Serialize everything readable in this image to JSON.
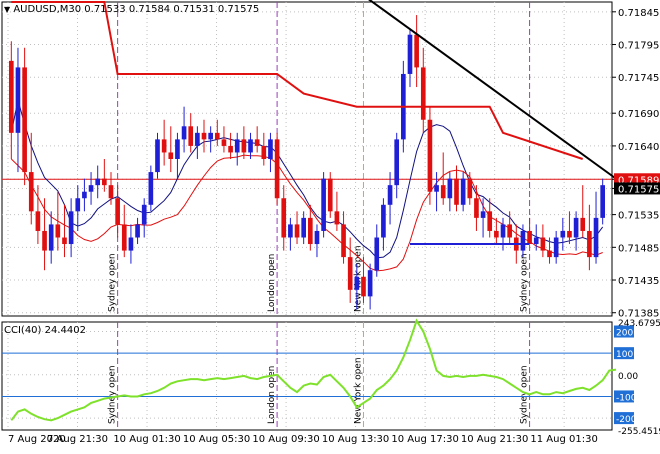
{
  "header": {
    "symbol": "AUDUSD,M30",
    "ohlc": "0.71533 0.71584 0.71531 0.71575",
    "text": "AUDUSD,M30  0.71533 0.71584 0.71531 0.71575"
  },
  "colors": {
    "background": "#ffffff",
    "grid": "#c0c0c0",
    "bull_candle": "#1f1fd6",
    "bear_candle": "#e01010",
    "trendline": "#000000",
    "resistance_line": "#e01010",
    "support_line": "#1f1fd6",
    "ma_fast": "#e01010",
    "ma_slow": "#101080",
    "cci_line": "#7ee12a",
    "session_line": "#9a3fb8",
    "ny_line": "#f0a020",
    "price_tag_current": "#000000",
    "price_tag_red": "#e01010",
    "cci_level_200": "#1f6fd6",
    "cci_level_minus100": "#1f6fd6"
  },
  "chart_data": [
    {
      "type": "candlestick",
      "title": "AUDUSD,M30",
      "price_axis_ticks": [
        "0.71845",
        "0.71795",
        "0.71745",
        "0.71690",
        "0.71640",
        "0.71589",
        "0.71575",
        "0.71535",
        "0.71485",
        "0.71435",
        "0.71385"
      ],
      "current_price": "0.71575",
      "horizontal_level": "0.71589",
      "ylim": [
        0.7138,
        0.7186
      ],
      "time_axis_labels": [
        "7 Aug 2020",
        "7 Aug 21:30",
        "10 Aug 01:30",
        "10 Aug 05:30",
        "10 Aug 09:30",
        "10 Aug 13:30",
        "10 Aug 17:30",
        "10 Aug 21:30",
        "11 Aug 01:30"
      ],
      "session_markers": [
        {
          "label": "Sydney open",
          "index": 16
        },
        {
          "label": "London open",
          "index": 40
        },
        {
          "label": "New York open",
          "index": 53
        },
        {
          "label": "Sydney open",
          "index": 78
        }
      ],
      "candles": [
        [
          0.7177,
          0.718,
          0.7162,
          0.7166
        ],
        [
          0.7166,
          0.7179,
          0.716,
          0.7176
        ],
        [
          0.7176,
          0.7179,
          0.7158,
          0.716
        ],
        [
          0.716,
          0.7166,
          0.7152,
          0.7154
        ],
        [
          0.7154,
          0.7158,
          0.7149,
          0.7151
        ],
        [
          0.7151,
          0.7156,
          0.7145,
          0.7148
        ],
        [
          0.7148,
          0.7154,
          0.7146,
          0.7152
        ],
        [
          0.7152,
          0.7157,
          0.7148,
          0.715
        ],
        [
          0.715,
          0.7155,
          0.7147,
          0.7149
        ],
        [
          0.7149,
          0.7156,
          0.7147,
          0.7154
        ],
        [
          0.7154,
          0.7158,
          0.7151,
          0.7156
        ],
        [
          0.7156,
          0.7159,
          0.7154,
          0.7157
        ],
        [
          0.7157,
          0.716,
          0.7155,
          0.7158
        ],
        [
          0.7158,
          0.7161,
          0.7156,
          0.7159
        ],
        [
          0.7159,
          0.7162,
          0.7157,
          0.7158
        ],
        [
          0.7158,
          0.716,
          0.7155,
          0.7156
        ],
        [
          0.7156,
          0.7158,
          0.715,
          0.7152
        ],
        [
          0.7152,
          0.7155,
          0.7147,
          0.7148
        ],
        [
          0.7148,
          0.7152,
          0.7146,
          0.715
        ],
        [
          0.715,
          0.7153,
          0.7149,
          0.7152
        ],
        [
          0.7152,
          0.7156,
          0.715,
          0.7155
        ],
        [
          0.7155,
          0.7161,
          0.7154,
          0.716
        ],
        [
          0.716,
          0.7166,
          0.7159,
          0.7165
        ],
        [
          0.7165,
          0.7168,
          0.7161,
          0.7163
        ],
        [
          0.7163,
          0.7167,
          0.716,
          0.7162
        ],
        [
          0.7162,
          0.7166,
          0.7159,
          0.7165
        ],
        [
          0.7165,
          0.717,
          0.7163,
          0.7167
        ],
        [
          0.7167,
          0.7169,
          0.7163,
          0.7164
        ],
        [
          0.7164,
          0.7167,
          0.7162,
          0.7166
        ],
        [
          0.7166,
          0.7168,
          0.7163,
          0.7165
        ],
        [
          0.7165,
          0.7167,
          0.7163,
          0.7166
        ],
        [
          0.7166,
          0.7168,
          0.7164,
          0.7165
        ],
        [
          0.7165,
          0.7167,
          0.7163,
          0.7164
        ],
        [
          0.7164,
          0.7166,
          0.7162,
          0.7163
        ],
        [
          0.7163,
          0.7166,
          0.7161,
          0.7165
        ],
        [
          0.7165,
          0.7167,
          0.7162,
          0.7163
        ],
        [
          0.7163,
          0.7166,
          0.7162,
          0.7165
        ],
        [
          0.7165,
          0.7167,
          0.7163,
          0.7164
        ],
        [
          0.7164,
          0.7166,
          0.7161,
          0.7162
        ],
        [
          0.7162,
          0.7166,
          0.716,
          0.7165
        ],
        [
          0.7165,
          0.7166,
          0.7155,
          0.7156
        ],
        [
          0.7156,
          0.7158,
          0.7148,
          0.715
        ],
        [
          0.715,
          0.7153,
          0.7148,
          0.7152
        ],
        [
          0.7152,
          0.7154,
          0.7149,
          0.715
        ],
        [
          0.715,
          0.7154,
          0.7149,
          0.7153
        ],
        [
          0.7153,
          0.7155,
          0.7148,
          0.7149
        ],
        [
          0.7149,
          0.7152,
          0.7147,
          0.7151
        ],
        [
          0.7151,
          0.716,
          0.715,
          0.7159
        ],
        [
          0.7159,
          0.716,
          0.7153,
          0.7154
        ],
        [
          0.7154,
          0.7157,
          0.7151,
          0.7152
        ],
        [
          0.7152,
          0.7154,
          0.7146,
          0.7147
        ],
        [
          0.7147,
          0.715,
          0.714,
          0.7142
        ],
        [
          0.7142,
          0.7146,
          0.7139,
          0.7144
        ],
        [
          0.7144,
          0.7147,
          0.714,
          0.7141
        ],
        [
          0.7141,
          0.7146,
          0.7139,
          0.7145
        ],
        [
          0.7145,
          0.7152,
          0.7144,
          0.715
        ],
        [
          0.715,
          0.7156,
          0.7148,
          0.7155
        ],
        [
          0.7155,
          0.716,
          0.7152,
          0.7158
        ],
        [
          0.7158,
          0.7166,
          0.7156,
          0.7165
        ],
        [
          0.7165,
          0.7177,
          0.7163,
          0.7175
        ],
        [
          0.7175,
          0.7182,
          0.7173,
          0.7181
        ],
        [
          0.7181,
          0.7184,
          0.7173,
          0.7176
        ],
        [
          0.7176,
          0.7179,
          0.7166,
          0.7168
        ],
        [
          0.7168,
          0.717,
          0.7155,
          0.7157
        ],
        [
          0.7157,
          0.716,
          0.7154,
          0.7158
        ],
        [
          0.7158,
          0.7163,
          0.7155,
          0.7156
        ],
        [
          0.7156,
          0.716,
          0.7154,
          0.7159
        ],
        [
          0.7159,
          0.7161,
          0.7154,
          0.7155
        ],
        [
          0.7155,
          0.716,
          0.7154,
          0.7159
        ],
        [
          0.7159,
          0.716,
          0.7155,
          0.7156
        ],
        [
          0.7156,
          0.7158,
          0.7151,
          0.7153
        ],
        [
          0.7153,
          0.7156,
          0.715,
          0.7154
        ],
        [
          0.7154,
          0.7156,
          0.715,
          0.7151
        ],
        [
          0.7151,
          0.7153,
          0.7149,
          0.715
        ],
        [
          0.715,
          0.7153,
          0.7148,
          0.7152
        ],
        [
          0.7152,
          0.7154,
          0.7149,
          0.715
        ],
        [
          0.715,
          0.7152,
          0.7146,
          0.7148
        ],
        [
          0.7148,
          0.7152,
          0.7147,
          0.7151
        ],
        [
          0.7151,
          0.7153,
          0.7149,
          0.7149
        ],
        [
          0.7149,
          0.7152,
          0.7148,
          0.715
        ],
        [
          0.715,
          0.7152,
          0.7147,
          0.7148
        ],
        [
          0.7148,
          0.715,
          0.7146,
          0.7147
        ],
        [
          0.7147,
          0.7151,
          0.7146,
          0.715
        ],
        [
          0.715,
          0.7153,
          0.7148,
          0.7151
        ],
        [
          0.7151,
          0.7154,
          0.7149,
          0.715
        ],
        [
          0.715,
          0.7154,
          0.7148,
          0.7153
        ],
        [
          0.7153,
          0.7158,
          0.715,
          0.7151
        ],
        [
          0.7151,
          0.7155,
          0.7145,
          0.7147
        ],
        [
          0.7147,
          0.7157,
          0.7146,
          0.7153
        ],
        [
          0.7153,
          0.7159,
          0.7152,
          0.7158
        ]
      ]
    },
    {
      "type": "line",
      "title": "CCI(40) 24.4402",
      "label": "CCI(40)",
      "value": "24.4402",
      "axis_ticks": [
        "243.6795",
        "200",
        "100",
        "0.00",
        "-100",
        "-200",
        "-255.4519"
      ],
      "ylim": [
        -255,
        244
      ],
      "values": [
        -210,
        -170,
        -160,
        -180,
        -195,
        -205,
        -210,
        -200,
        -185,
        -170,
        -160,
        -150,
        -130,
        -120,
        -110,
        -105,
        -100,
        -95,
        -100,
        -100,
        -90,
        -85,
        -75,
        -60,
        -40,
        -30,
        -25,
        -20,
        -20,
        -25,
        -20,
        -15,
        -20,
        -15,
        -10,
        -5,
        -15,
        -20,
        -10,
        -5,
        0,
        -30,
        -60,
        -80,
        -50,
        -40,
        -45,
        -10,
        0,
        -30,
        -60,
        -100,
        -150,
        -130,
        -110,
        -70,
        -50,
        -20,
        20,
        80,
        160,
        250,
        200,
        120,
        20,
        -5,
        -10,
        -5,
        -10,
        -5,
        -5,
        0,
        -5,
        -10,
        -20,
        -40,
        -60,
        -80,
        -90,
        -80,
        -90,
        -90,
        -80,
        -85,
        -75,
        -65,
        -60,
        -70,
        -50,
        -25,
        20,
        24
      ]
    }
  ]
}
